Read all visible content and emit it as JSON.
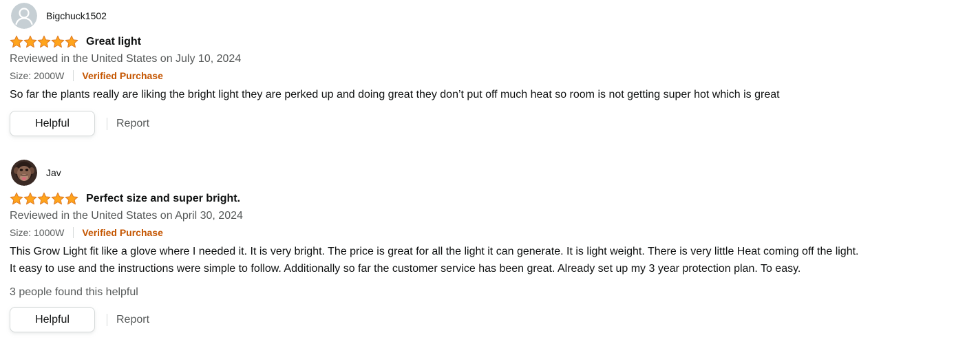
{
  "colors": {
    "star": "#ffa41c",
    "verified": "#c45500",
    "secondary_text": "#565959",
    "primary_text": "#0f1111"
  },
  "reviews": [
    {
      "profile_name": "Bigchuck1502",
      "avatar_icon": "default-user-avatar-icon",
      "rating": 5,
      "rating_max": 5,
      "title": "Great light",
      "date": "Reviewed in the United States on July 10, 2024",
      "size": "Size: 2000W",
      "verified": "Verified Purchase",
      "body": [
        "So far the plants really are liking the bright light they are perked up and doing great they don’t put off much heat so room is not getting super hot which is great"
      ],
      "helpful_count": "",
      "helpful_label": "Helpful",
      "report_label": "Report"
    },
    {
      "profile_name": "Jav",
      "avatar_icon": "chimpanzee-avatar-icon",
      "rating": 5,
      "rating_max": 5,
      "title": "Perfect size and super bright.",
      "date": "Reviewed in the United States on April 30, 2024",
      "size": "Size: 1000W",
      "verified": "Verified Purchase",
      "body": [
        "This Grow Light fit like a glove where I needed it. It is very bright. The price is great for all the light it can generate. It is light weight. There is very little Heat coming off the light.",
        "It easy to use and the instructions were simple to follow. Additionally so far the customer service has been great. Already set up my 3 year protection plan. To easy."
      ],
      "helpful_count": "3 people found this helpful",
      "helpful_label": "Helpful",
      "report_label": "Report"
    }
  ]
}
